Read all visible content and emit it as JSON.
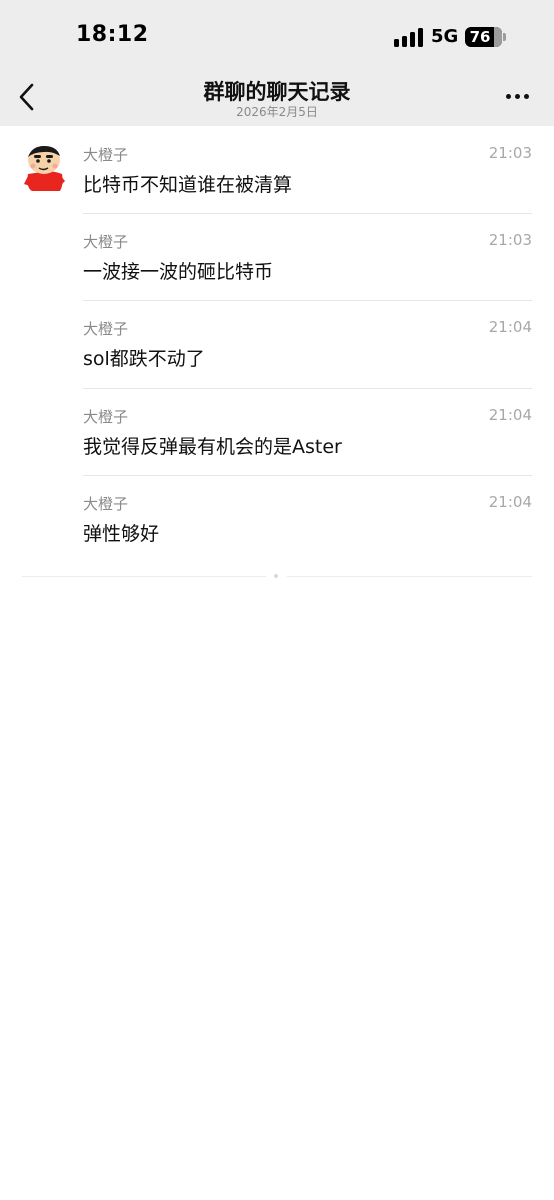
{
  "status_bar": {
    "time": "18:12",
    "network": "5G",
    "battery": "76"
  },
  "nav": {
    "title": "群聊的聊天记录",
    "subtitle": "2026年2月5日"
  },
  "icons": {
    "back": "chevron-left-icon",
    "more": "more-dots-icon",
    "signal": "signal-bars-icon",
    "avatar": "cartoon-character-avatar"
  },
  "messages": [
    {
      "sender": "大橙子",
      "time": "21:03",
      "text": "比特币不知道谁在被清算"
    },
    {
      "sender": "大橙子",
      "time": "21:03",
      "text": "一波接一波的砸比特币"
    },
    {
      "sender": "大橙子",
      "time": "21:04",
      "text": "sol都跌不动了"
    },
    {
      "sender": "大橙子",
      "time": "21:04",
      "text": "我觉得反弹最有机会的是Aster"
    },
    {
      "sender": "大橙子",
      "time": "21:04",
      "text": "弹性够好"
    }
  ],
  "colors": {
    "header_bg": "#ededed",
    "avatar_shirt": "#e8251f",
    "avatar_skin": "#f6d2a8"
  }
}
